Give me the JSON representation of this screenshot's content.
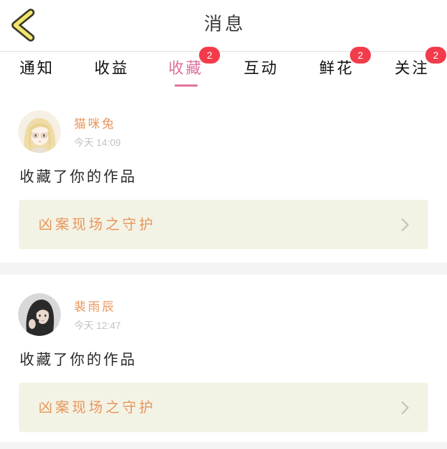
{
  "header": {
    "title": "消息"
  },
  "icons": {
    "back": "chevron-left-icon",
    "work_link": "chevron-right-icon",
    "avatar": "user-avatar"
  },
  "colors": {
    "accent": "#E0709C",
    "highlight_text": "#E8955C",
    "badge": "#F23C4C",
    "work_card_bg": "#F3F3E5",
    "back_icon": "#F3E66C"
  },
  "tabs": [
    {
      "label": "通知"
    },
    {
      "label": "收益"
    },
    {
      "label": "收藏",
      "active": true,
      "badge": "2"
    },
    {
      "label": "互动"
    },
    {
      "label": "鲜花",
      "badge": "2"
    },
    {
      "label": "关注",
      "badge": "2"
    }
  ],
  "messages": [
    {
      "user": "猫咪兔",
      "time": "今天 14:09",
      "action": "收藏了你的作品",
      "work_title": "凶案现场之守护"
    },
    {
      "user": "裴雨辰",
      "time": "今天 12:47",
      "action": "收藏了你的作品",
      "work_title": "凶案现场之守护"
    }
  ]
}
